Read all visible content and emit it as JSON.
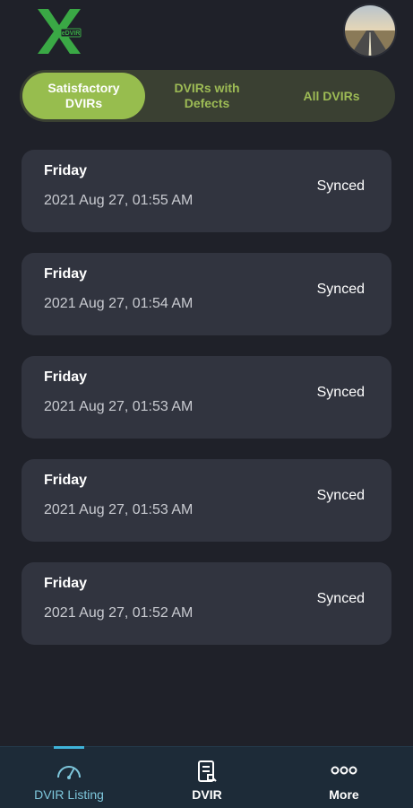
{
  "header": {
    "logo_alt": "eDVIR",
    "avatar_icon": "road-photo-avatar"
  },
  "tabs": [
    {
      "label": "Satisfactory\nDVIRs",
      "active": true
    },
    {
      "label": "DVIRs with\nDefects",
      "active": false
    },
    {
      "label": "All DVIRs",
      "active": false
    }
  ],
  "records": [
    {
      "day": "Friday",
      "timestamp": "2021 Aug 27, 01:55 AM",
      "status": "Synced"
    },
    {
      "day": "Friday",
      "timestamp": "2021 Aug 27, 01:54 AM",
      "status": "Synced"
    },
    {
      "day": "Friday",
      "timestamp": "2021 Aug 27, 01:53 AM",
      "status": "Synced"
    },
    {
      "day": "Friday",
      "timestamp": "2021 Aug 27, 01:53 AM",
      "status": "Synced"
    },
    {
      "day": "Friday",
      "timestamp": "2021 Aug 27, 01:52 AM",
      "status": "Synced"
    }
  ],
  "bottom_nav": [
    {
      "label": "DVIR Listing",
      "icon": "gauge-icon",
      "active": true
    },
    {
      "label": "DVIR",
      "icon": "document-icon",
      "active": false
    },
    {
      "label": "More",
      "icon": "more-dots-icon",
      "active": false
    }
  ],
  "colors": {
    "background": "#1f2129",
    "card": "#31343f",
    "accent_green": "#97bd4e",
    "accent_blue": "#3fb3d9"
  }
}
